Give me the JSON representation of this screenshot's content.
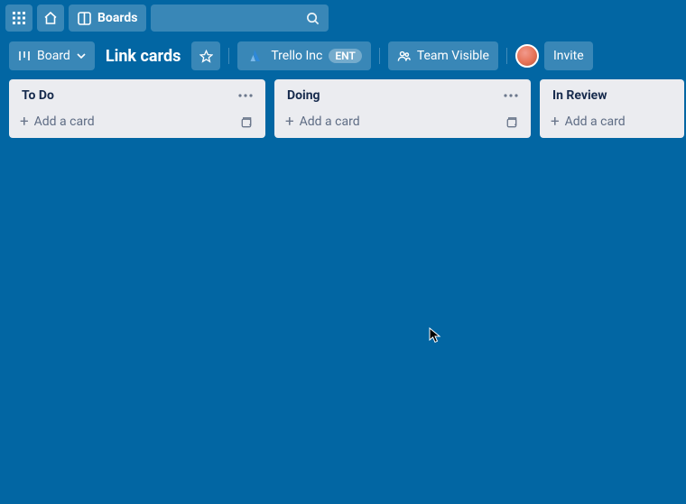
{
  "topnav": {
    "boards_label": "Boards"
  },
  "header": {
    "board_button_label": "Board",
    "board_title": "Link cards",
    "org_name": "Trello Inc",
    "org_badge": "ENT",
    "visibility_label": "Team Visible",
    "invite_label": "Invite"
  },
  "lists": [
    {
      "title": "To Do",
      "add_label": "Add a card"
    },
    {
      "title": "Doing",
      "add_label": "Add a card"
    },
    {
      "title": "In Review",
      "add_label": "Add a card"
    }
  ]
}
